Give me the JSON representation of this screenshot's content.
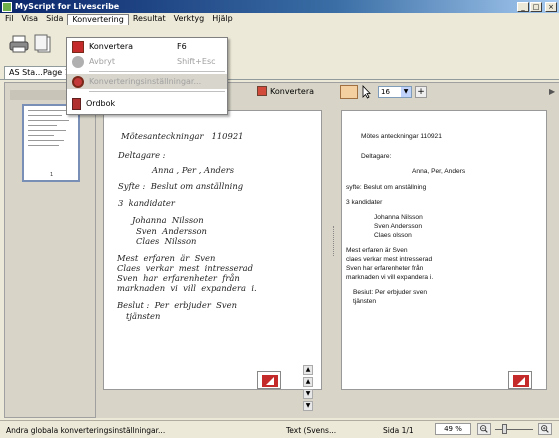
{
  "window": {
    "title": "MyScript for Livescribe"
  },
  "menubar": [
    "Fil",
    "Visa",
    "Sida",
    "Konvertering",
    "Resultat",
    "Verktyg",
    "Hjälp"
  ],
  "tabs": [
    {
      "label": "AS Sta...Page 1"
    }
  ],
  "dropdown": {
    "items": [
      {
        "label": "Konvertera",
        "shortcut": "F6"
      },
      {
        "label": "Avbryt",
        "shortcut": "Shift+Esc"
      },
      {
        "label": "Konverteringsinställningar..."
      },
      {
        "label": "Ordbok"
      }
    ]
  },
  "view_toolbar": {
    "convert_label": "Konvertera",
    "size_value": "16"
  },
  "handwritten": [
    "Mötesanteckningar   110921",
    "Deltagare :",
    "Anna , Per , Anders",
    "Syfte :  Beslut om anställning",
    "3  kandidater",
    "Johanna  Nilsson",
    "Sven  Andersson",
    "Claes  Nilsson",
    "Mest  erfaren  är  Sven",
    "Claes  verkar  mest  intresserad",
    "Sven  har  erfarenheter  från",
    "marknaden  vi  vill  expandera  i.",
    "Beslut :  Per  erbjuder  Sven",
    "tjänsten"
  ],
  "converted": [
    "Mötes anteckningar 110921",
    "Deltagare:",
    "Anna, Per, Anders",
    "syfte: Beslut om anställning",
    "3 kandidater",
    "Johanna Nilsson",
    "Sven Andersson",
    "Claes olsson",
    "Mest erfaren är Sven",
    "claes verkar mest intresserad",
    "Sven har erfarenheter från",
    "marknaden vi vill expandera i.",
    "Besiut: Per erbjuder sven",
    "tjänsten"
  ],
  "thumbnail": {
    "page_number": "1"
  },
  "status": {
    "message": "Andra globala konverteringsinställningar...",
    "language": "Text (Svens...",
    "page": "Sida 1/1",
    "zoom": "49 %"
  },
  "colors": {
    "titlebar": "#0a246a",
    "convert_icon": "#c42a2a",
    "hand_tool": "#f4d0a0"
  }
}
